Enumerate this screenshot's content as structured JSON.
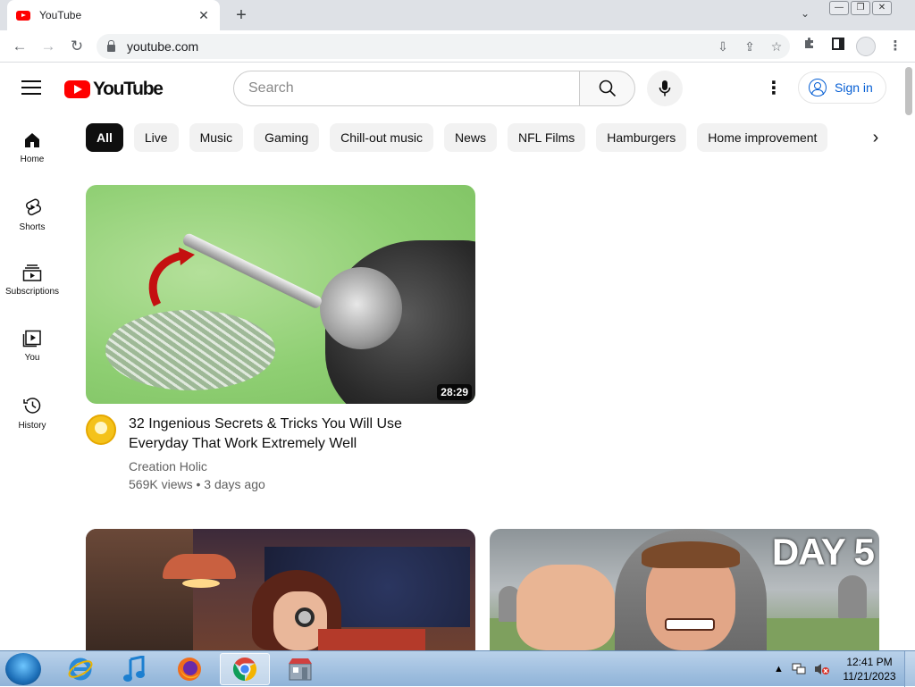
{
  "browser": {
    "tab_title": "YouTube",
    "tab_close": "✕",
    "new_tab": "+",
    "url": "youtube.com"
  },
  "header": {
    "logo_text": "YouTube",
    "search_placeholder": "Search",
    "signin_label": "Sign in"
  },
  "sidebar": {
    "items": [
      {
        "label": "Home",
        "icon": "home-icon"
      },
      {
        "label": "Shorts",
        "icon": "shorts-icon"
      },
      {
        "label": "Subscriptions",
        "icon": "subscriptions-icon"
      },
      {
        "label": "You",
        "icon": "you-icon"
      },
      {
        "label": "History",
        "icon": "history-icon"
      }
    ]
  },
  "chips": [
    "All",
    "Live",
    "Music",
    "Gaming",
    "Chill-out music",
    "News",
    "NFL Films",
    "Hamburgers",
    "Home improvement"
  ],
  "videos": [
    {
      "title": "32 Ingenious Secrets & Tricks You Will Use Everyday That Work Extremely Well",
      "channel": "Creation Holic",
      "stats": "569K views • 3 days ago",
      "duration": "28:29"
    },
    {
      "title": "",
      "channel": "",
      "stats": "",
      "duration": ""
    },
    {
      "title": "",
      "channel": "",
      "stats": "",
      "duration": "",
      "overlay_text": "DAY 5"
    }
  ],
  "taskbar": {
    "time": "12:41 PM",
    "date": "11/21/2023"
  },
  "colors": {
    "brand_red": "#ff0000",
    "link_blue": "#065fd4",
    "chip_active": "#0f0f0f",
    "chip_bg": "#f2f2f2"
  }
}
